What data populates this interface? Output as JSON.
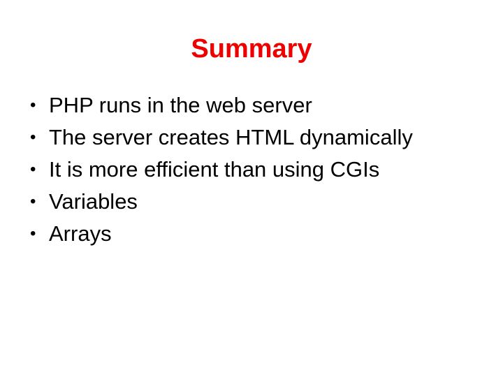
{
  "slide": {
    "title": "Summary",
    "title_color": "#ee0000",
    "background_color": "#ffffff",
    "text_color": "#000000",
    "bullet_glyph": "•",
    "bullets": [
      {
        "text": "PHP runs in the web server"
      },
      {
        "text": "The server creates HTML dynamically"
      },
      {
        "text": "It is more efficient than using CGIs"
      },
      {
        "text": "Variables"
      },
      {
        "text": "Arrays"
      }
    ]
  }
}
